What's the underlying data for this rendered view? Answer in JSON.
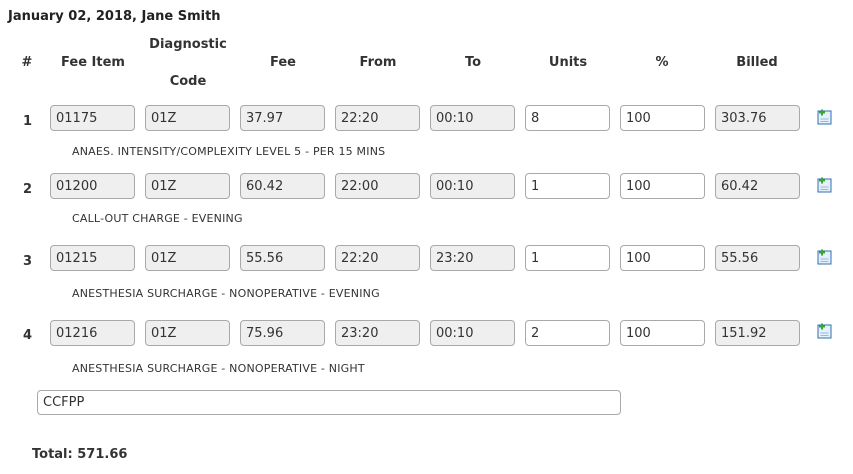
{
  "header": {
    "title": "January 02, 2018, Jane Smith"
  },
  "columns": {
    "num": "#",
    "fee_item": "Fee Item",
    "diag_line1": "Diagnostic",
    "diag_line2": "Code",
    "fee": "Fee",
    "from": "From",
    "to": "To",
    "units": "Units",
    "percent": "%",
    "billed": "Billed"
  },
  "rows": [
    {
      "num": "1",
      "fee_item": "01175",
      "diag": "01Z",
      "fee": "37.97",
      "from": "22:20",
      "to": "00:10",
      "units": "8",
      "percent": "100",
      "billed": "303.76",
      "description": "ANAES. INTENSITY/COMPLEXITY LEVEL 5 - PER 15 MINS"
    },
    {
      "num": "2",
      "fee_item": "01200",
      "diag": "01Z",
      "fee": "60.42",
      "from": "22:00",
      "to": "00:10",
      "units": "1",
      "percent": "100",
      "billed": "60.42",
      "description": "CALL-OUT CHARGE - EVENING"
    },
    {
      "num": "3",
      "fee_item": "01215",
      "diag": "01Z",
      "fee": "55.56",
      "from": "22:20",
      "to": "23:20",
      "units": "1",
      "percent": "100",
      "billed": "55.56",
      "description": "ANESTHESIA SURCHARGE - NONOPERATIVE - EVENING"
    },
    {
      "num": "4",
      "fee_item": "01216",
      "diag": "01Z",
      "fee": "75.96",
      "from": "23:20",
      "to": "00:10",
      "units": "2",
      "percent": "100",
      "billed": "151.92",
      "description": "ANESTHESIA SURCHARGE - NONOPERATIVE - NIGHT"
    }
  ],
  "notes": {
    "value": "CCFPP"
  },
  "total": {
    "label": "Total: 571.66"
  },
  "icons": {
    "add_row": "add-document-icon"
  },
  "colors": {
    "readonly_bg": "#efefef",
    "icon_blue": "#2f6fb3",
    "icon_plus": "#3aa635"
  }
}
